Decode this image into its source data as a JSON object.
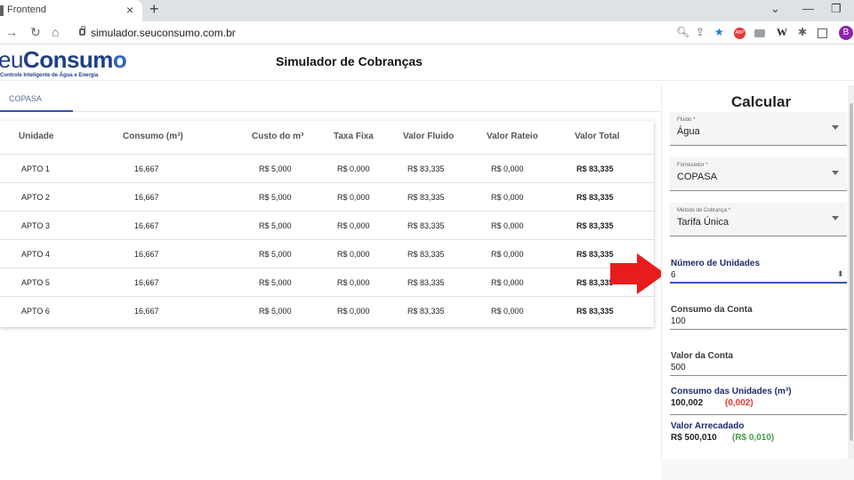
{
  "browser": {
    "tab_title": "Frontend",
    "tab_close": "×",
    "new_tab": "+",
    "url": "simulador.seuconsumo.com.br",
    "profile_initial": "B",
    "ext_abp": "ABP",
    "ext_w": "W",
    "win_min": "—",
    "win_chevron": "⌄",
    "win_restore": "❐"
  },
  "app": {
    "logo_eu": "eu",
    "logo_consum": "Consum",
    "logo_o": "o",
    "logo_sub": "Controle Inteligente de Água e Energia",
    "title": "Simulador de Cobranças"
  },
  "tabs": [
    {
      "label": "COPASA"
    }
  ],
  "table": {
    "headers": [
      "Unidade",
      "Consumo (m³)",
      "Custo do m³",
      "Taxa Fixa",
      "Valor Fluido",
      "Valor Rateio",
      "Valor Total"
    ],
    "rows": [
      [
        "APTO 1",
        "16,667",
        "R$ 5,000",
        "R$ 0,000",
        "R$ 83,335",
        "R$ 0,000",
        "R$ 83,335"
      ],
      [
        "APTO 2",
        "16,667",
        "R$ 5,000",
        "R$ 0,000",
        "R$ 83,335",
        "R$ 0,000",
        "R$ 83,335"
      ],
      [
        "APTO 3",
        "16,667",
        "R$ 5,000",
        "R$ 0,000",
        "R$ 83,335",
        "R$ 0,000",
        "R$ 83,335"
      ],
      [
        "APTO 4",
        "16,667",
        "R$ 5,000",
        "R$ 0,000",
        "R$ 83,335",
        "R$ 0,000",
        "R$ 83,335"
      ],
      [
        "APTO 5",
        "16,667",
        "R$ 5,000",
        "R$ 0,000",
        "R$ 83,335",
        "R$ 0,000",
        "R$ 83,335"
      ],
      [
        "APTO 6",
        "16,667",
        "R$ 5,000",
        "R$ 0,000",
        "R$ 83,335",
        "R$ 0,000",
        "R$ 83,335"
      ]
    ]
  },
  "panel": {
    "title": "Calcular",
    "fluido": {
      "label": "Fluido *",
      "value": "Água"
    },
    "fornecedor": {
      "label": "Fornecedor *",
      "value": "COPASA"
    },
    "metodo": {
      "label": "Metodo de Cobrança *",
      "value": "Tarifa Única"
    },
    "numero_unidades": {
      "label": "Número de Unidades",
      "value": "6"
    },
    "consumo_conta": {
      "label": "Consumo da Conta",
      "value": "100"
    },
    "valor_conta": {
      "label": "Valor da Conta",
      "value": "500"
    },
    "consumo_unidades": {
      "label": "Consumo das Unidades (m³)",
      "value": "100,002",
      "diff": "(0,002)"
    },
    "valor_arrecadado": {
      "label": "Valor Arrecadado",
      "value": "R$ 500,010",
      "diff": "(R$ 0,010)"
    }
  },
  "colors": {
    "accent": "#3f51b5",
    "diff_negative": "#e53935",
    "diff_positive": "#43a047",
    "arrow": "#e81c1c"
  }
}
